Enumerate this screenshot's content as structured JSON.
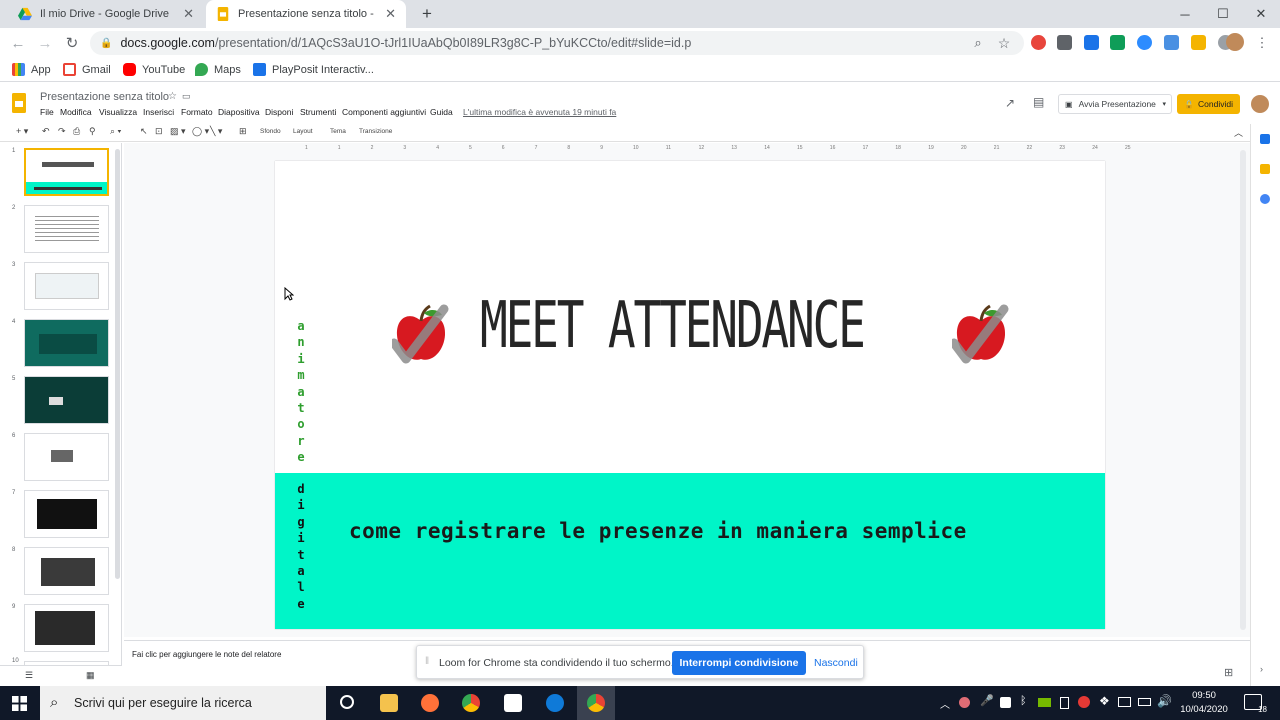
{
  "browser": {
    "tabs": [
      {
        "title": "Il mio Drive - Google Drive",
        "icon": "google-drive-icon",
        "active": false
      },
      {
        "title": "Presentazione senza titolo - Presentazioni Google",
        "icon": "google-slides-icon",
        "active": true
      }
    ],
    "new_tab": "+",
    "url_host": "docs.google.com",
    "url_path": "/presentation/d/1AQcS3aU1O-tJrl1IUaAbQb0I89LR3g8C-P_bYuKCCto/edit#slide=id.p",
    "bookmarks": [
      "App",
      "Gmail",
      "YouTube",
      "Maps",
      "PlayPosit Interactiv..."
    ]
  },
  "slides_app": {
    "doc_title": "Presentazione senza titolo",
    "menus": [
      "File",
      "Modifica",
      "Visualizza",
      "Inserisci",
      "Formato",
      "Diapositiva",
      "Disponi",
      "Strumenti",
      "Componenti aggiuntivi",
      "Guida"
    ],
    "last_edit": "L'ultima modifica è avvenuta 19 minuti fa",
    "present_label": "Avvia Presentazione",
    "share_label": "Condividi",
    "toolbar_text": {
      "background": "Sfondo",
      "layout": "Layout",
      "theme": "Tema",
      "transition": "Transizione"
    },
    "ruler_ticks": [
      "1",
      "1",
      "2",
      "3",
      "4",
      "5",
      "6",
      "7",
      "8",
      "9",
      "10",
      "11",
      "12",
      "13",
      "14",
      "15",
      "16",
      "17",
      "18",
      "19",
      "20",
      "21",
      "22",
      "23",
      "24",
      "25"
    ],
    "thumbnail_numbers": [
      "1",
      "2",
      "3",
      "4",
      "5",
      "6",
      "7",
      "8",
      "9",
      "10"
    ],
    "notes_placeholder": "Fai clic per aggiungere le note del relatore"
  },
  "slide": {
    "title": "MEET ATTENDANCE",
    "subtitle": "come registrare le presenze in maniera semplice",
    "vertical_word_1": "animatore",
    "vertical_word_2": "digitale",
    "band_color": "#00f5c8",
    "vertical_word_1_color": "#2e9e2e"
  },
  "loom": {
    "message": "Loom for Chrome sta condividendo il tuo schermo.",
    "stop_label": "Interrompi condivisione",
    "hide_label": "Nascondi"
  },
  "taskbar": {
    "search_placeholder": "Scrivi qui per eseguire la ricerca",
    "time": "09:50",
    "date": "10/04/2020",
    "notification_count": "18"
  }
}
